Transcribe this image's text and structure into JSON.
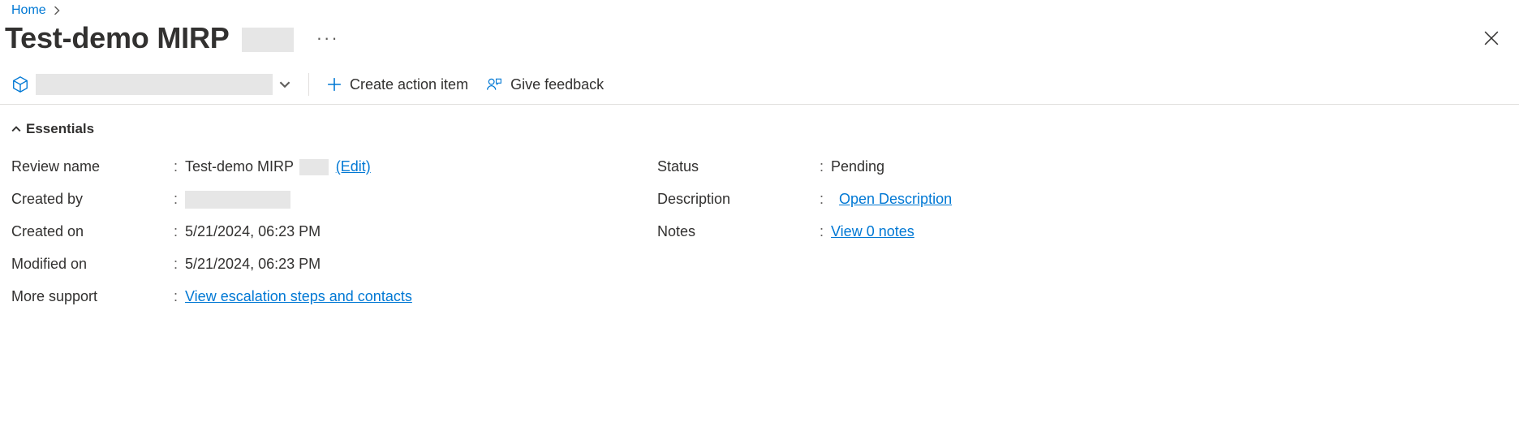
{
  "breadcrumb": {
    "home": "Home"
  },
  "title": {
    "main": "Test-demo MIRP"
  },
  "toolbar": {
    "create_action": "Create action item",
    "give_feedback": "Give feedback"
  },
  "essentials": {
    "header": "Essentials",
    "left": {
      "review_name_label": "Review name",
      "review_name_value": "Test-demo MIRP",
      "review_name_edit": "(Edit)",
      "created_by_label": "Created by",
      "created_on_label": "Created on",
      "created_on_value": "5/21/2024, 06:23 PM",
      "modified_on_label": "Modified on",
      "modified_on_value": "5/21/2024, 06:23 PM",
      "more_support_label": "More support",
      "more_support_link": "View escalation steps and contacts"
    },
    "right": {
      "status_label": "Status",
      "status_value": "Pending",
      "description_label": "Description",
      "description_link": "Open Description",
      "notes_label": "Notes",
      "notes_link": "View 0 notes"
    }
  }
}
